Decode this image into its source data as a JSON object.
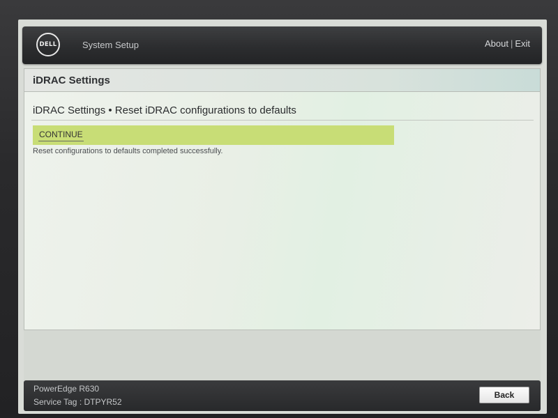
{
  "header": {
    "logo_text": "DELL",
    "app_title": "System Setup",
    "about_label": "About",
    "separator": "|",
    "exit_label": "Exit"
  },
  "section": {
    "title": "iDRAC Settings"
  },
  "page": {
    "breadcrumb": "iDRAC Settings • Reset iDRAC configurations to defaults",
    "continue_label": "CONTINUE",
    "status_message": "Reset configurations to defaults completed successfully."
  },
  "footer": {
    "model": "PowerEdge R630",
    "service_tag": "Service Tag : DTPYR52",
    "back_label": "Back"
  },
  "colors": {
    "highlight_row": "#c8dd76",
    "header_bar": "#2c2d2f",
    "panel_background": "#eef2ec"
  }
}
